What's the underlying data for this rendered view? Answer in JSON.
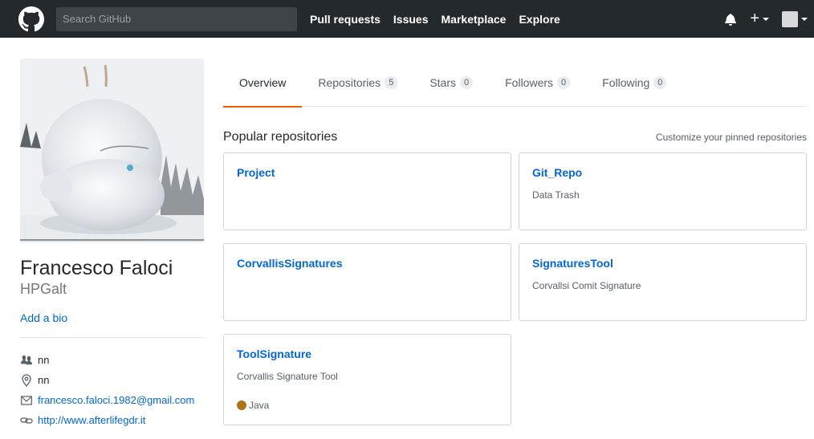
{
  "header": {
    "logo": "github-mark-icon",
    "search_placeholder": "Search GitHub",
    "nav": [
      "Pull requests",
      "Issues",
      "Marketplace",
      "Explore"
    ],
    "icons": [
      "bell-icon",
      "plus-icon",
      "avatar-icon"
    ]
  },
  "profile": {
    "name": "Francesco Faloci",
    "username": "HPGalt",
    "bio_link": "Add a bio",
    "details": [
      {
        "icon": "organization-icon",
        "text": "nn"
      },
      {
        "icon": "location-icon",
        "text": "nn"
      },
      {
        "icon": "mail-icon",
        "text": "francesco.faloci.1982@gmail.com"
      },
      {
        "icon": "link-icon",
        "text": "http://www.afterlifegdr.it"
      }
    ]
  },
  "tabs": [
    {
      "label": "Overview",
      "count": null,
      "selected": true
    },
    {
      "label": "Repositories",
      "count": "5",
      "selected": false
    },
    {
      "label": "Stars",
      "count": "0",
      "selected": false
    },
    {
      "label": "Followers",
      "count": "0",
      "selected": false
    },
    {
      "label": "Following",
      "count": "0",
      "selected": false
    }
  ],
  "pinned": {
    "title": "Popular repositories",
    "customize": "Customize your pinned repositories",
    "repos": [
      {
        "name": "Project",
        "description": "",
        "language": ""
      },
      {
        "name": "Git_Repo",
        "description": "Data Trash",
        "language": ""
      },
      {
        "name": "CorvallisSignatures",
        "description": "",
        "language": ""
      },
      {
        "name": "SignaturesTool",
        "description": "Corvallsi Comit Signature",
        "language": ""
      },
      {
        "name": "ToolSignature",
        "description": "Corvallis Signature Tool",
        "language": "Java",
        "language_color": "#b07219"
      }
    ]
  },
  "colors": {
    "header_bg": "#24292e",
    "link": "#0366d6",
    "tab_underline": "#e36209",
    "java": "#b07219"
  }
}
